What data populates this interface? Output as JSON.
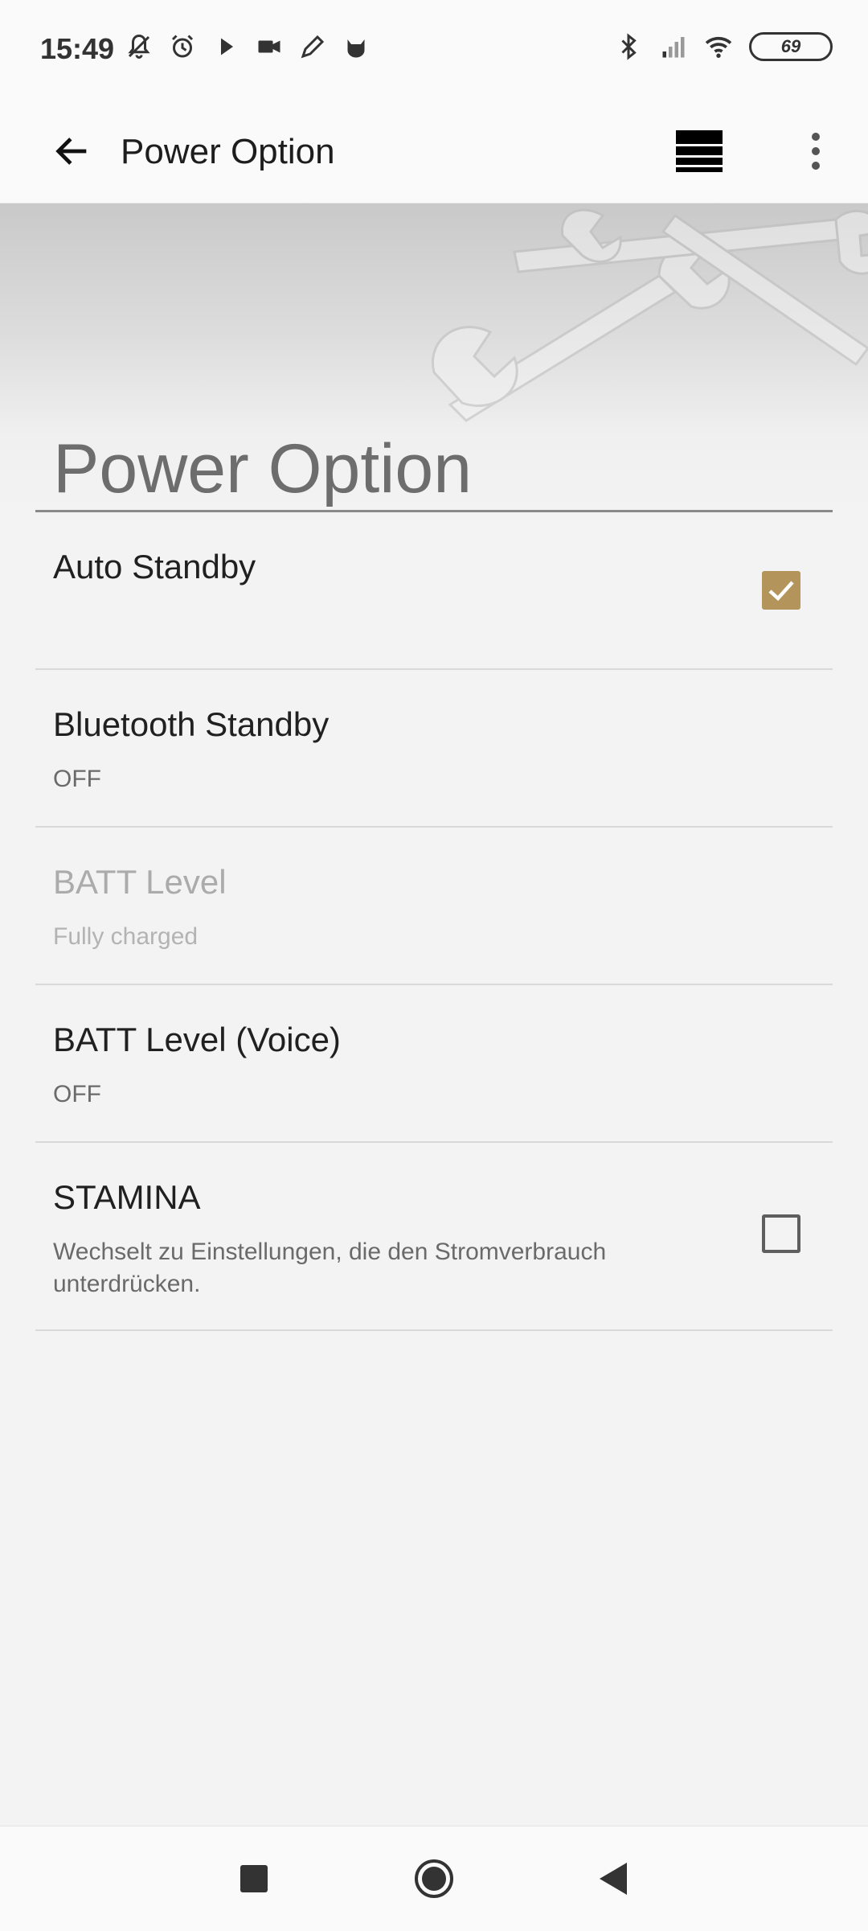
{
  "status_bar": {
    "time": "15:49",
    "left_icons": [
      "notifications-off-icon",
      "alarm-icon",
      "play-icon",
      "video-camera-icon",
      "pencil-icon",
      "cat-icon"
    ],
    "right_icons": [
      "bluetooth-icon",
      "cellular-signal-icon",
      "wifi-icon"
    ],
    "battery_level": "69"
  },
  "app_bar": {
    "back_icon": "arrow-back-icon",
    "title": "Power Option",
    "list_icon": "list-view-icon",
    "more_icon": "more-vertical-icon"
  },
  "banner": {
    "title": "Power Option"
  },
  "settings": [
    {
      "title": "Auto Standby",
      "summary": "",
      "control": "checkbox",
      "checked": true,
      "enabled": true
    },
    {
      "title": "Bluetooth Standby",
      "summary": "OFF",
      "control": "none",
      "enabled": true
    },
    {
      "title": "BATT Level",
      "summary": "Fully charged",
      "control": "none",
      "enabled": false
    },
    {
      "title": "BATT Level (Voice)",
      "summary": "OFF",
      "control": "none",
      "enabled": true
    },
    {
      "title": "STAMINA",
      "summary": "Wechselt zu Einstellungen, die den Stromverbrauch unterdrücken.",
      "control": "checkbox",
      "checked": false,
      "enabled": true
    }
  ],
  "nav_bar": {
    "recents_icon": "square-icon",
    "home_icon": "circle-home-icon",
    "back_icon": "triangle-back-icon"
  },
  "colors": {
    "accent": "#b3955b",
    "background": "#f3f3f3",
    "appbar": "#fafafa"
  }
}
